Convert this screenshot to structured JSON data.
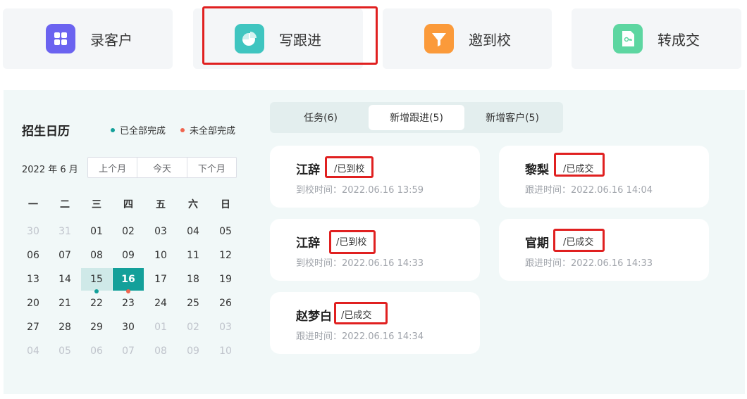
{
  "actions": [
    {
      "label": "录客户",
      "icon": "grid-icon",
      "color": "#6b63f0"
    },
    {
      "label": "写跟进",
      "icon": "pie-icon",
      "color": "#3fc5c0"
    },
    {
      "label": "邀到校",
      "icon": "funnel-icon",
      "color": "#fb9a3a"
    },
    {
      "label": "转成交",
      "icon": "document-key-icon",
      "color": "#5dd6a1"
    }
  ],
  "calendar": {
    "title": "招生日历",
    "legend": [
      {
        "label": "已全部完成",
        "color": "#14a09a"
      },
      {
        "label": "未全部完成",
        "color": "#f0654f"
      }
    ],
    "month_label": "2022 年 6 月",
    "nav": [
      "上个月",
      "今天",
      "下个月"
    ],
    "weekdays": [
      "一",
      "二",
      "三",
      "四",
      "五",
      "六",
      "日"
    ],
    "weeks": [
      [
        "30",
        "31",
        "01",
        "02",
        "03",
        "04",
        "05"
      ],
      [
        "06",
        "07",
        "08",
        "09",
        "10",
        "11",
        "12"
      ],
      [
        "13",
        "14",
        "15",
        "16",
        "17",
        "18",
        "19"
      ],
      [
        "20",
        "21",
        "22",
        "23",
        "24",
        "25",
        "26"
      ],
      [
        "27",
        "28",
        "29",
        "30",
        "01",
        "02",
        "03"
      ],
      [
        "04",
        "05",
        "06",
        "07",
        "08",
        "09",
        "10"
      ]
    ]
  },
  "tabs": [
    "任务(6)",
    "新增跟进(5)",
    "新增客户(5)"
  ],
  "active_tab": 1,
  "followups": [
    {
      "name": "江辞",
      "status": "/已到校",
      "time": "到校时间：2022.06.16 13:59"
    },
    {
      "name": "黎梨",
      "status": "/已成交",
      "time": "跟进时间：2022.06.16 14:04"
    },
    {
      "name": "江辞",
      "status": "/已到校",
      "time": "到校时间：2022.06.16 14:33"
    },
    {
      "name": "官期",
      "status": "/已成交",
      "time": "跟进时间：2022.06.16 14:33"
    },
    {
      "name": "赵梦白",
      "status": "/已成交",
      "time": "跟进时间：2022.06.16 14:34"
    }
  ]
}
